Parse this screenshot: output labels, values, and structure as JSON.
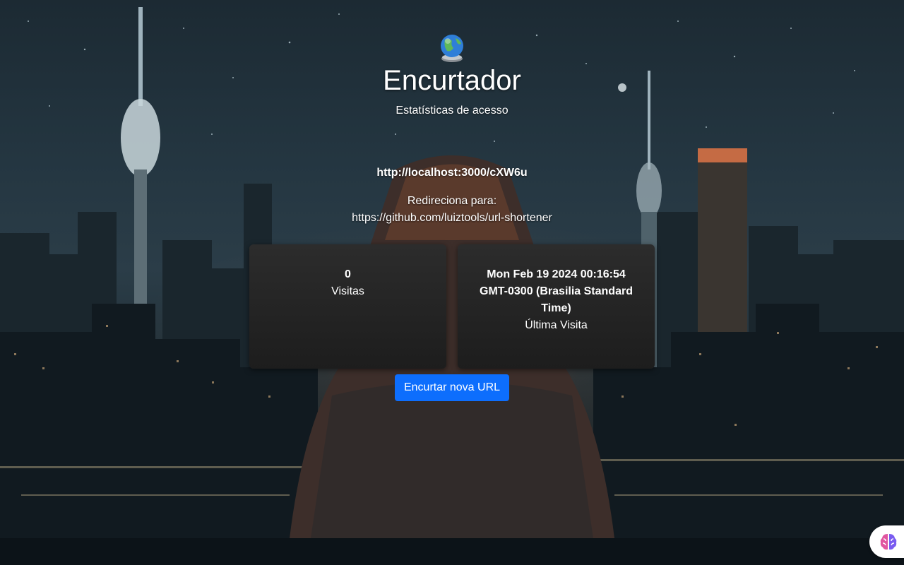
{
  "header": {
    "logo_icon": "globe-icon",
    "title": "Encurtador",
    "subtitle": "Estatísticas de acesso"
  },
  "link": {
    "short_url": "http://localhost:3000/cXW6u",
    "redirect_label": "Redireciona para:",
    "redirect_url": "https://github.com/luiztools/url-shortener"
  },
  "stats": {
    "visits": {
      "value": "0",
      "label": "Visitas"
    },
    "last_visit": {
      "value": "Mon Feb 19 2024 00:16:54 GMT-0300 (Brasilia Standard Time)",
      "label": "Última Visita"
    }
  },
  "actions": {
    "new_url_button": "Encurtar nova URL"
  },
  "extension": {
    "icon": "brain-icon"
  },
  "colors": {
    "button_bg": "#0d6efd",
    "card_bg": "#222222",
    "text": "#ffffff"
  }
}
